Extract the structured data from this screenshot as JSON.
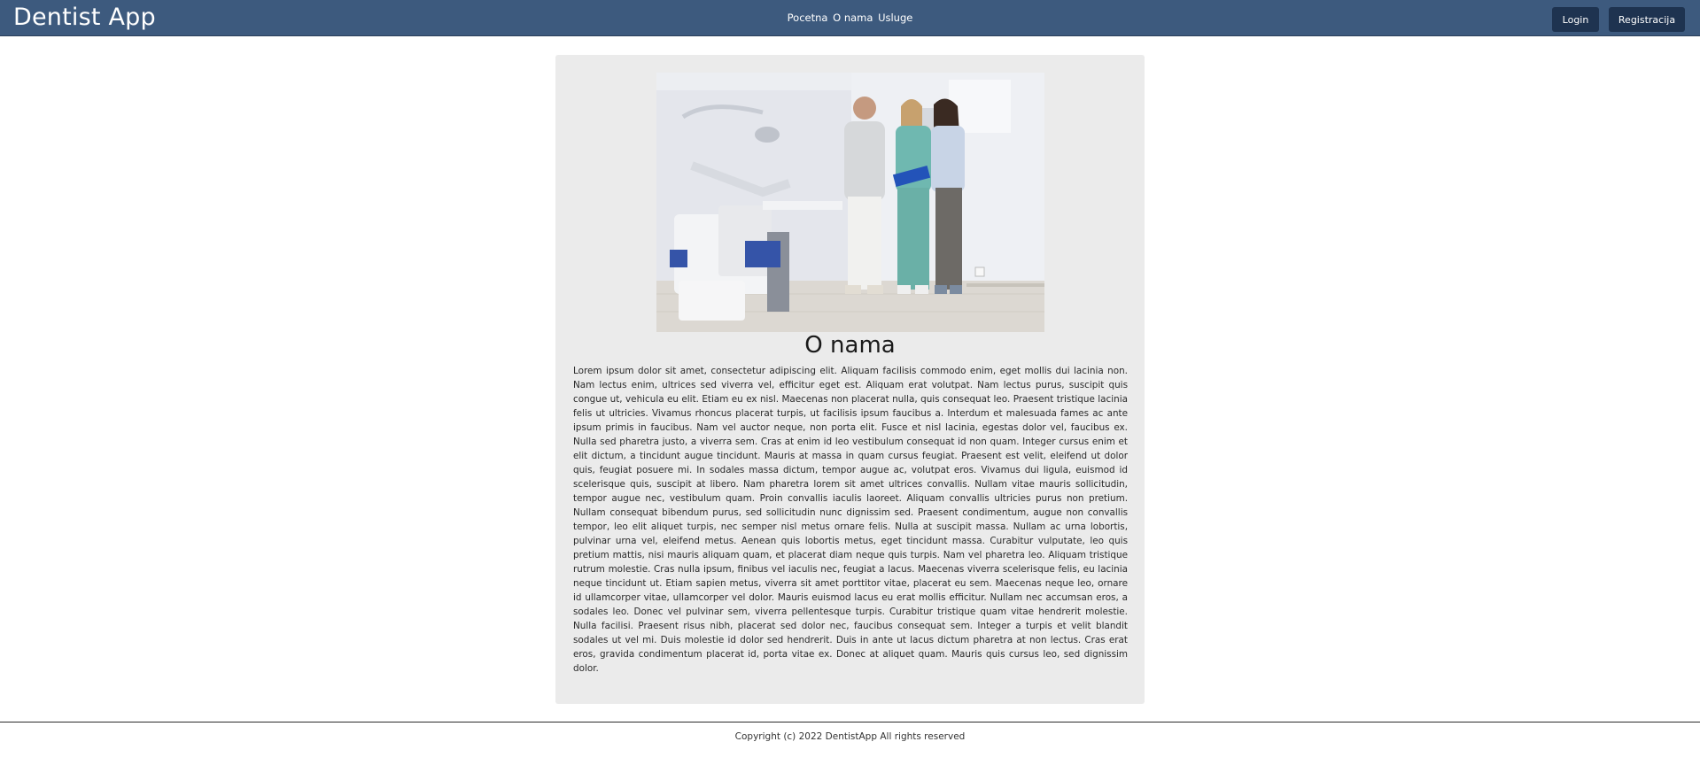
{
  "navbar": {
    "brand": "Dentist App",
    "links": [
      "Pocetna",
      "O nama",
      "Usluge"
    ],
    "login_label": "Login",
    "register_label": "Registracija"
  },
  "main": {
    "image_alt": "Dentists in clinic",
    "title": "O nama",
    "body": "Lorem ipsum dolor sit amet, consectetur adipiscing elit. Aliquam facilisis commodo enim, eget mollis dui lacinia non. Nam lectus enim, ultrices sed viverra vel, efficitur eget est. Aliquam erat volutpat. Nam lectus purus, suscipit quis congue ut, vehicula eu elit. Etiam eu ex nisl. Maecenas non placerat nulla, quis consequat leo. Praesent tristique lacinia felis ut ultricies. Vivamus rhoncus placerat turpis, ut facilisis ipsum faucibus a. Interdum et malesuada fames ac ante ipsum primis in faucibus. Nam vel auctor neque, non porta elit. Fusce et nisl lacinia, egestas dolor vel, faucibus ex. Nulla sed pharetra justo, a viverra sem. Cras at enim id leo vestibulum consequat id non quam. Integer cursus enim et elit dictum, a tincidunt augue tincidunt. Mauris at massa in quam cursus feugiat. Praesent est velit, eleifend ut dolor quis, feugiat posuere mi. In sodales massa dictum, tempor augue ac, volutpat eros. Vivamus dui ligula, euismod id scelerisque quis, suscipit at libero. Nam pharetra lorem sit amet ultrices convallis. Nullam vitae mauris sollicitudin, tempor augue nec, vestibulum quam. Proin convallis iaculis laoreet. Aliquam convallis ultricies purus non pretium. Nullam consequat bibendum purus, sed sollicitudin nunc dignissim sed. Praesent condimentum, augue non convallis tempor, leo elit aliquet turpis, nec semper nisl metus ornare felis. Nulla at suscipit massa. Nullam ac urna lobortis, pulvinar urna vel, eleifend metus. Aenean quis lobortis metus, eget tincidunt massa. Curabitur vulputate, leo quis pretium mattis, nisi mauris aliquam quam, et placerat diam neque quis turpis. Nam vel pharetra leo. Aliquam tristique rutrum molestie. Cras nulla ipsum, finibus vel iaculis nec, feugiat a lacus. Maecenas viverra scelerisque felis, eu lacinia neque tincidunt ut. Etiam sapien metus, viverra sit amet porttitor vitae, placerat eu sem. Maecenas neque leo, ornare id ullamcorper vitae, ullamcorper vel dolor. Mauris euismod lacus eu erat mollis efficitur. Nullam nec accumsan eros, a sodales leo. Donec vel pulvinar sem, viverra pellentesque turpis. Curabitur tristique quam vitae hendrerit molestie. Nulla facilisi. Praesent risus nibh, placerat sed dolor nec, faucibus consequat sem. Integer a turpis et velit blandit sodales ut vel mi. Duis molestie id dolor sed hendrerit. Duis in ante ut lacus dictum pharetra at non lectus. Cras erat eros, gravida condimentum placerat id, porta vitae ex. Donec at aliquet quam. Mauris quis cursus leo, sed dignissim dolor."
  },
  "footer": {
    "copyright": "Copyright (c) 2022 DentistApp All rights reserved"
  },
  "colors": {
    "navbar": "#3d5a7e",
    "button": "#1e3350",
    "card": "#ebebeb"
  }
}
